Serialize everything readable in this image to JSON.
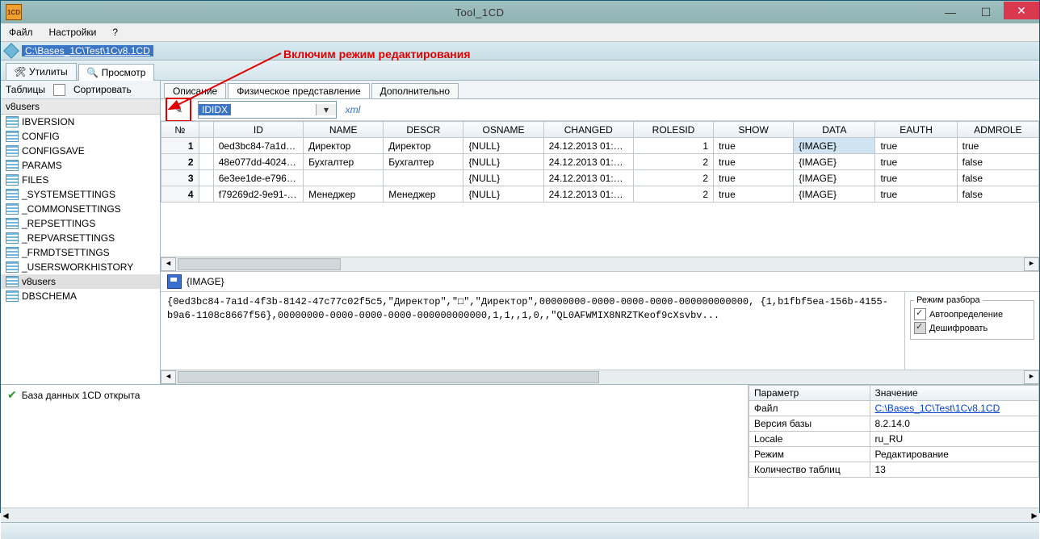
{
  "window": {
    "title": "Tool_1CD",
    "icon_label": "1CD"
  },
  "menubar": {
    "file": "Файл",
    "settings": "Настройки",
    "help": "?"
  },
  "pathbar": {
    "path": "C:\\Bases_1C\\Test\\1Cv8.1CD"
  },
  "annotation": "Включим режим редактирования",
  "main_tabs": {
    "utilities": "Утилиты",
    "view": "Просмотр"
  },
  "sidebar": {
    "header_tables": "Таблицы",
    "header_sort": "Сортировать",
    "caption": "v8users",
    "items": [
      "IBVERSION",
      "CONFIG",
      "CONFIGSAVE",
      "PARAMS",
      "FILES",
      "_SYSTEMSETTINGS",
      "_COMMONSETTINGS",
      "_REPSETTINGS",
      "_REPVARSETTINGS",
      "_FRMDTSETTINGS",
      "_USERSWORKHISTORY",
      "v8users",
      "DBSCHEMA"
    ],
    "selected": "v8users"
  },
  "inner_tabs": {
    "desc": "Описание",
    "phys": "Физическое представление",
    "extra": "Дополнительно"
  },
  "toolbar2": {
    "combo_value": "IDIDX",
    "xml_label": "xml"
  },
  "grid": {
    "headers": [
      "№",
      "",
      "ID",
      "NAME",
      "DESCR",
      "OSNAME",
      "CHANGED",
      "ROLESID",
      "SHOW",
      "DATA",
      "EAUTH",
      "ADMROLE"
    ],
    "rows": [
      {
        "n": "1",
        "id": "0ed3bc84-7a1d-4...",
        "name": "Директор",
        "descr": "Директор",
        "osname": "{NULL}",
        "changed": "24.12.2013 01:13...",
        "rolesid": "1",
        "show": "true",
        "data": "{IMAGE}",
        "eauth": "true",
        "admrole": "true"
      },
      {
        "n": "2",
        "id": "48e077dd-4024-4...",
        "name": "Бухгалтер",
        "descr": "Бухгалтер",
        "osname": "{NULL}",
        "changed": "24.12.2013 01:13...",
        "rolesid": "2",
        "show": "true",
        "data": "{IMAGE}",
        "eauth": "true",
        "admrole": "false"
      },
      {
        "n": "3",
        "id": "6e3ee1de-e796-4...",
        "name": "",
        "descr": "",
        "osname": "{NULL}",
        "changed": "24.12.2013 01:13...",
        "rolesid": "2",
        "show": "true",
        "data": "{IMAGE}",
        "eauth": "true",
        "admrole": "false"
      },
      {
        "n": "4",
        "id": "f79269d2-9e91-4...",
        "name": "Менеджер",
        "descr": "Менеджер",
        "osname": "{NULL}",
        "changed": "24.12.2013 01:13...",
        "rolesid": "2",
        "show": "true",
        "data": "{IMAGE}",
        "eauth": "true",
        "admrole": "false"
      }
    ]
  },
  "detail": {
    "save_label": "{IMAGE}",
    "text": "{0ed3bc84-7a1d-4f3b-8142-47c77c02f5c5,\"Директор\",\"□\",\"Директор\",00000000-0000-0000-0000-000000000000,\n{1,b1fbf5ea-156b-4155-b9a6-1108c8667f56},00000000-0000-0000-0000-000000000000,1,1,,1,0,,\"QL0AFWMIX8NRZTKeof9cXsvbv...",
    "parse_title": "Режим разбора",
    "auto": "Автоопределение",
    "decrypt": "Дешифровать"
  },
  "status": {
    "db_open": "База данных 1CD открыта"
  },
  "info": {
    "h_param": "Параметр",
    "h_value": "Значение",
    "rows": [
      {
        "p": "Файл",
        "v": "C:\\Bases_1C\\Test\\1Cv8.1CD",
        "link": true
      },
      {
        "p": "Версия базы",
        "v": "8.2.14.0"
      },
      {
        "p": "Locale",
        "v": "ru_RU"
      },
      {
        "p": "Режим",
        "v": "Редактирование"
      },
      {
        "p": "Количество таблиц",
        "v": "13"
      }
    ]
  }
}
